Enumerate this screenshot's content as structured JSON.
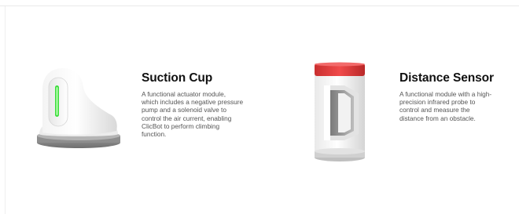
{
  "products": [
    {
      "title": "Suction Cup",
      "description": "A functional actuator module, which includes a negative pressure pump and a solenoid valve to control the air current, enabling ClicBot to perform climbing function.",
      "accent_color": "#3ddc3d"
    },
    {
      "title": "Distance Sensor",
      "description": "A functional module with a high-precision infrared probe to control and measure the distance from an obstacle.",
      "accent_color": "#e03b3b"
    }
  ]
}
